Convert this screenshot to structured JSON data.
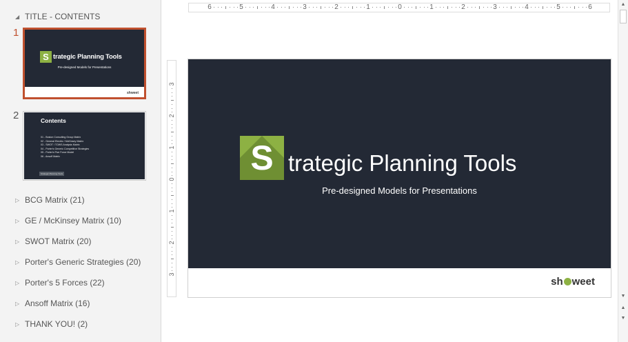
{
  "section_header": "TITLE - CONTENTS",
  "slides": [
    {
      "number": "1",
      "title_letter": "S",
      "title_rest": "trategic Planning Tools",
      "subtitle": "Pre-designed Models for Presentations",
      "logo": {
        "before": "sh",
        "after": "weet"
      }
    },
    {
      "number": "2",
      "title": "Contents",
      "items": [
        "01 - Boston Consulting Group Matrix",
        "02 - General Electric / McKinsey Matrix",
        "03 - SWOT / TOWS Analysis Matrix",
        "04 - Porter's Generic Competitive Strategies",
        "05 - Porter's Five Force Model",
        "06 - Ansoff Matrix"
      ],
      "footer": "Strategic Planning Tools"
    }
  ],
  "sections": [
    "BCG Matrix (21)",
    "GE / McKinsey Matrix (10)",
    "SWOT Matrix (20)",
    "Porter's Generic Strategies (20)",
    "Porter's 5 Forces (22)",
    "Ansoff Matrix (16)",
    "THANK YOU! (2)"
  ],
  "ruler": {
    "horizontal": [
      "6",
      "5",
      "4",
      "3",
      "2",
      "1",
      "0",
      "1",
      "2",
      "3",
      "4",
      "5",
      "6"
    ],
    "vertical": [
      "3",
      "2",
      "1",
      "0",
      "1",
      "2",
      "3"
    ]
  },
  "colors": {
    "accent": "#c0502e",
    "slide_bg": "#232935",
    "brand_green": "#8db143"
  },
  "icons": {
    "expanded": "triangle-down-left",
    "collapsed": "triangle-right"
  }
}
